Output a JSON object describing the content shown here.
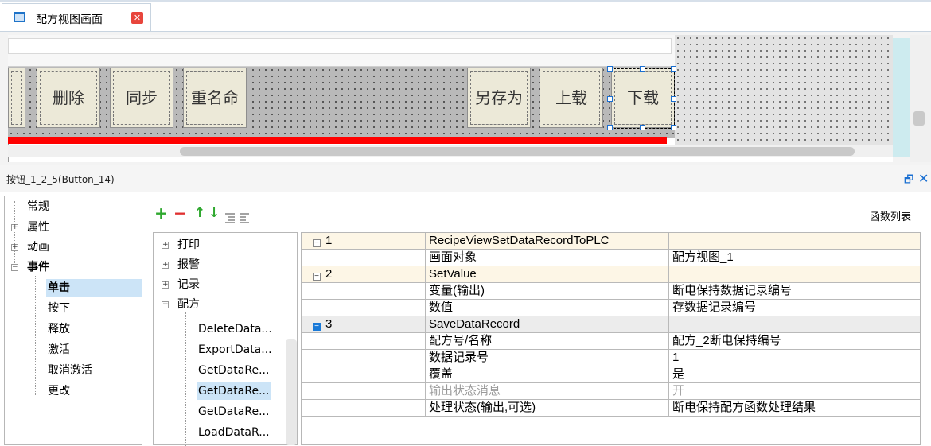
{
  "tab": {
    "title": "配方视图画面",
    "close": "✕"
  },
  "canvas": {
    "buttons": [
      {
        "name": "partial",
        "label": ""
      },
      {
        "name": "delete",
        "label": "删除"
      },
      {
        "name": "sync",
        "label": "同步"
      },
      {
        "name": "rename",
        "label": "重名命"
      },
      {
        "name": "save-as",
        "label": "另存为"
      },
      {
        "name": "upload",
        "label": "上载"
      },
      {
        "name": "download",
        "label": "下载"
      }
    ]
  },
  "properties": {
    "title": "按钮_1_2_5(Button_14)",
    "pin": "🗗",
    "close": "✕"
  },
  "left_tree": [
    {
      "label": "常规",
      "expander": ""
    },
    {
      "label": "属性",
      "expander": "+"
    },
    {
      "label": "动画",
      "expander": "+"
    },
    {
      "label": "事件",
      "expander": "−"
    },
    {
      "label": "单击"
    },
    {
      "label": "按下"
    },
    {
      "label": "释放"
    },
    {
      "label": "激活"
    },
    {
      "label": "取消激活"
    },
    {
      "label": "更改"
    }
  ],
  "toolbar": {
    "add": "+",
    "remove": "−",
    "up": "↑",
    "down": "↓",
    "func_list_label": "函数列表"
  },
  "func_tree": {
    "groups": [
      {
        "label": "打印",
        "expander": "+"
      },
      {
        "label": "报警",
        "expander": "+"
      },
      {
        "label": "记录",
        "expander": "+"
      },
      {
        "label": "配方",
        "expander": "−"
      }
    ],
    "items": [
      "DeleteData...",
      "ExportData...",
      "GetDataRe...",
      "GetDataRe...",
      "GetDataRe...",
      "LoadDataR..."
    ]
  },
  "grid": {
    "rows": [
      {
        "c1": "1",
        "c2": "RecipeViewSetDataRecordToPLC",
        "c3": "",
        "head": true
      },
      {
        "c1": "",
        "c2": "画面对象",
        "c3": "配方视图_1"
      },
      {
        "c1": "2",
        "c2": "SetValue",
        "c3": "",
        "head": true
      },
      {
        "c1": "",
        "c2": "变量(输出)",
        "c3": "断电保持数据记录编号"
      },
      {
        "c1": "",
        "c2": "数值",
        "c3": "存数据记录编号"
      },
      {
        "c1": "3",
        "c2": "SaveDataRecord",
        "c3": "",
        "head": true
      },
      {
        "c1": "",
        "c2": "配方号/名称",
        "c3": "配方_2断电保持编号"
      },
      {
        "c1": "",
        "c2": "数据记录号",
        "c3": "1"
      },
      {
        "c1": "",
        "c2": "覆盖",
        "c3": "是"
      },
      {
        "c1": "",
        "c2": "输出状态消息",
        "c3": "开",
        "gray": true
      },
      {
        "c1": "",
        "c2": "处理状态(输出,可选)",
        "c3": "断电保持配方函数处理结果"
      }
    ]
  },
  "colors": {
    "accent": "#1a6fd1",
    "red_bar": "#ff0000",
    "header_row": "#fdf6e6",
    "selection": "#cce4f7"
  }
}
